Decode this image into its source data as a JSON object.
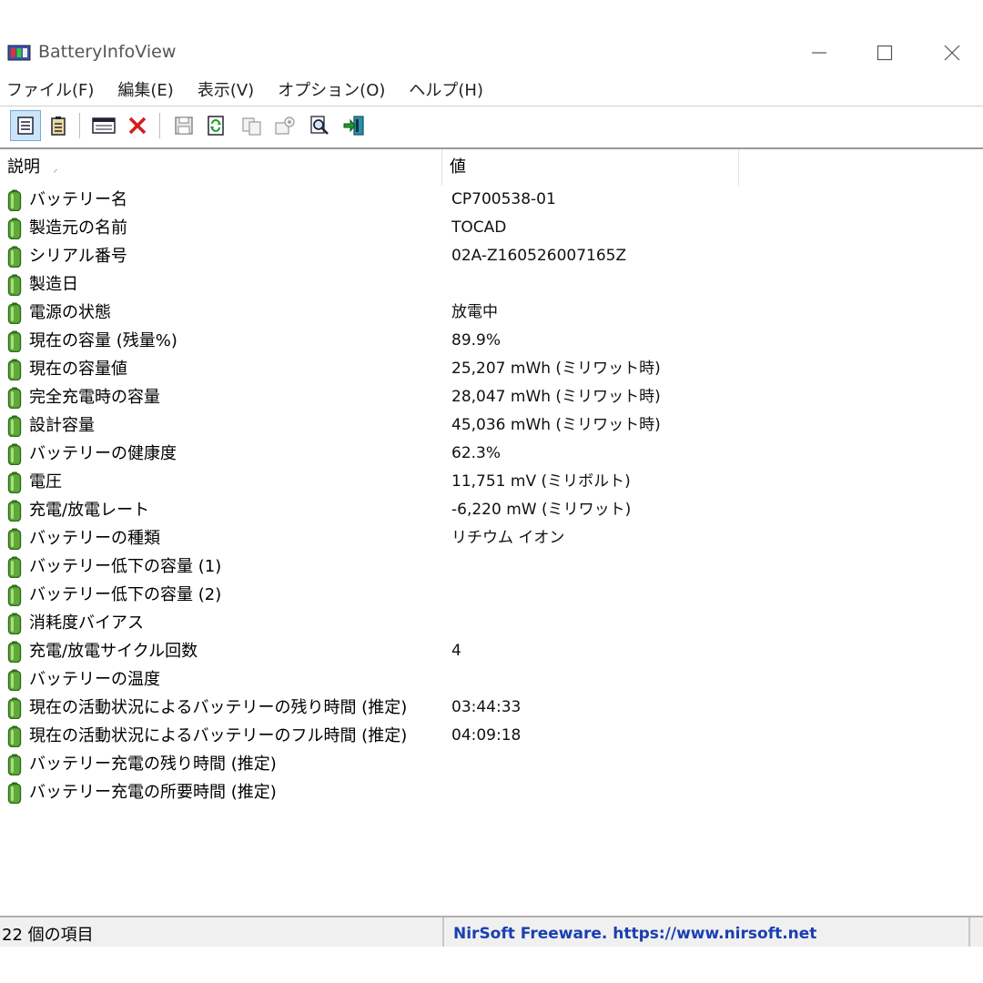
{
  "window": {
    "title": "BatteryInfoView",
    "controls": {
      "minimize": "—",
      "maximize": "☐",
      "close": "✕"
    }
  },
  "menu": [
    "ファイル(F)",
    "編集(E)",
    "表示(V)",
    "オプション(O)",
    "ヘルプ(H)"
  ],
  "toolbar": {
    "buttons": [
      "battery-info-mode-icon",
      "battery-log-mode-icon",
      "window-properties-icon",
      "delete-x-icon",
      "save-disk-icon",
      "refresh-icon",
      "copy-icon",
      "properties-icon",
      "find-icon",
      "exit-icon"
    ]
  },
  "columns": {
    "description": "説明",
    "value": "値"
  },
  "rows": [
    {
      "desc": "バッテリー名",
      "value": "CP700538-01"
    },
    {
      "desc": "製造元の名前",
      "value": "TOCAD"
    },
    {
      "desc": "シリアル番号",
      "value": "02A-Z160526007165Z"
    },
    {
      "desc": "製造日",
      "value": ""
    },
    {
      "desc": "電源の状態",
      "value": "放電中"
    },
    {
      "desc": "現在の容量 (残量%)",
      "value": "89.9%"
    },
    {
      "desc": "現在の容量値",
      "value": "25,207 mWh (ミリワット時)"
    },
    {
      "desc": "完全充電時の容量",
      "value": "28,047 mWh (ミリワット時)"
    },
    {
      "desc": "設計容量",
      "value": "45,036 mWh (ミリワット時)"
    },
    {
      "desc": "バッテリーの健康度",
      "value": "62.3%"
    },
    {
      "desc": "電圧",
      "value": "11,751 mV (ミリボルト)"
    },
    {
      "desc": "充電/放電レート",
      "value": "-6,220 mW (ミリワット)"
    },
    {
      "desc": "バッテリーの種類",
      "value": "リチウム イオン"
    },
    {
      "desc": "バッテリー低下の容量 (1)",
      "value": ""
    },
    {
      "desc": "バッテリー低下の容量 (2)",
      "value": ""
    },
    {
      "desc": "消耗度バイアス",
      "value": ""
    },
    {
      "desc": "充電/放電サイクル回数",
      "value": "4"
    },
    {
      "desc": "バッテリーの温度",
      "value": ""
    },
    {
      "desc": "現在の活動状況によるバッテリーの残り時間 (推定)",
      "value": "03:44:33"
    },
    {
      "desc": "現在の活動状況によるバッテリーのフル時間 (推定)",
      "value": "04:09:18"
    },
    {
      "desc": "バッテリー充電の残り時間 (推定)",
      "value": ""
    },
    {
      "desc": "バッテリー充電の所要時間 (推定)",
      "value": ""
    }
  ],
  "status": {
    "count": "22 個の項目",
    "link": "NirSoft Freeware. https://www.nirsoft.net"
  },
  "colors": {
    "battery_green": "#5fa83a",
    "battery_dark": "#2e6b1a",
    "link_blue": "#1a3fb0"
  }
}
